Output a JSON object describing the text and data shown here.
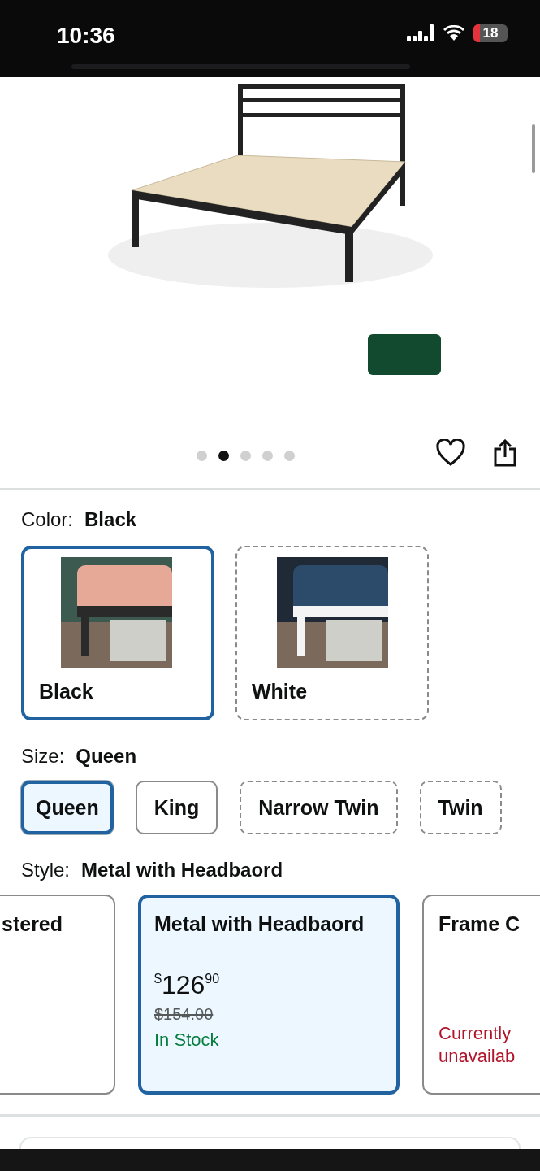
{
  "status_bar": {
    "time": "10:36",
    "battery": "18"
  },
  "gallery": {
    "dots": [
      {
        "selected": false
      },
      {
        "selected": true
      },
      {
        "selected": false
      },
      {
        "selected": false
      },
      {
        "selected": false
      }
    ]
  },
  "color": {
    "label": "Color:",
    "value": "Black",
    "options": [
      {
        "name": "Black",
        "selected": true,
        "available": true
      },
      {
        "name": "White",
        "selected": false,
        "available": false
      }
    ]
  },
  "size": {
    "label": "Size:",
    "value": "Queen",
    "options": [
      {
        "name": "Queen",
        "selected": true,
        "available": true
      },
      {
        "name": "King",
        "selected": false,
        "available": true
      },
      {
        "name": "Narrow Twin",
        "selected": false,
        "available": false
      },
      {
        "name": "Twin",
        "selected": false,
        "available": false
      }
    ]
  },
  "style": {
    "label": "Style:",
    "value": "Metal with Headbaord",
    "options": [
      {
        "name": "stered",
        "selected": false
      },
      {
        "name": "Metal with Headbaord",
        "selected": true,
        "price": {
          "symbol": "$",
          "whole": "126",
          "fraction": "90"
        },
        "list_price": "$154.00",
        "availability": {
          "kind": "in_stock",
          "text": "In Stock"
        }
      },
      {
        "name": "Frame C",
        "selected": false,
        "availability": {
          "kind": "unavailable",
          "text": "Currently unavailab"
        }
      }
    ]
  }
}
